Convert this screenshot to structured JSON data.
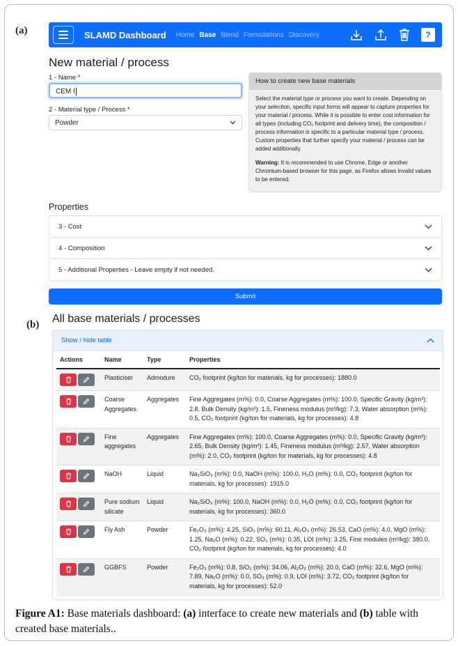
{
  "panel_labels": {
    "a": "(a)",
    "b": "(b)"
  },
  "navbar": {
    "brand": "SLAMD Dashboard",
    "links": [
      {
        "label": "Home",
        "active": false
      },
      {
        "label": "Base",
        "active": true
      },
      {
        "label": "Blend",
        "active": false
      },
      {
        "label": "Formulations",
        "active": false
      },
      {
        "label": "Discovery",
        "active": false
      }
    ],
    "icons": [
      "download-icon",
      "upload-icon",
      "trash-icon",
      "help-icon"
    ],
    "help_label": "?"
  },
  "form": {
    "title": "New material / process",
    "name_label": "1 - Name *",
    "name_value": "CEM I",
    "type_label": "2 - Material type / Process *",
    "type_value": "Powder"
  },
  "info": {
    "heading": "How to create new base materials",
    "paragraph": "Select the material type or process you want to create. Depending on your selection, specific input forms will appear to capture properties for your material / process. While it is possible to enter cost information for all types (including CO₂ footprint and delivery time), the composition / process information is specific to a particular material type / process. Custom properties that further specify your material / process can be added additionally.",
    "warning_label": "Warning:",
    "warning_text": " It is recommended to use Chrome, Edge or another Chromium-based browser for this page, as Firefox allows invalid values to be entered."
  },
  "properties": {
    "title": "Properties",
    "items": [
      "3 - Cost",
      "4 - Composition",
      "5 - Additional Properties - Leave empty if not needed."
    ],
    "submit_label": "Submit"
  },
  "materials": {
    "title": "All base materials / processes",
    "toggle_label": "Show / hide table",
    "columns": [
      "Actions",
      "Name",
      "Type",
      "Properties"
    ],
    "rows": [
      {
        "name": "Plasticiser",
        "type": "Admixture",
        "properties": "CO₂ footprint (kg/ton for materials, kg for processes): 1880.0"
      },
      {
        "name": "Coarse Aggregates",
        "type": "Aggregates",
        "properties": "Fine Aggregates (m%): 0.0, Coarse Aggregates (m%): 100.0, Specific Gravity (kg/m³): 2.8, Bulk Density (kg/m³): 1.5, Fineness modulus (m³/kg): 7.3, Water absorption (m%): 0.5, CO₂ footprint (kg/ton for materials, kg for processes): 4.8"
      },
      {
        "name": "Fine aggregates",
        "type": "Aggregates",
        "properties": "Fine Aggregates (m%): 100.0, Coarse Aggregates (m%): 0.0, Specific Gravity (kg/m³): 2.65, Bulk Density (kg/m³): 1.45, Fineness modulus (m³/kg): 2.57, Water absorption (m%): 2.0, CO₂ footprint (kg/ton for materials, kg for processes): 4.8"
      },
      {
        "name": "NaOH",
        "type": "Liquid",
        "properties": "Na₂SiO₃ (m%): 0.0, NaOH (m%): 100.0, H₂O (m%): 0.0, CO₂ footprint (kg/ton for materials, kg for processes): 1915.0"
      },
      {
        "name": "Pure sodium silicate",
        "type": "Liquid",
        "properties": "Na₂SiO₃ (m%): 100.0, NaOH (m%): 0.0, H₂O (m%): 0.0, CO₂ footprint (kg/ton for materials, kg for processes): 360.0"
      },
      {
        "name": "Fly Ash",
        "type": "Powder",
        "properties": "Fe₂O₃ (m%): 4.25, SiO₂ (m%): 60.11, Al₂O₃ (m%): 26.53, CaO (m%): 4.0, MgO (m%): 1.25, Na₂O (m%): 0.22, SO₃ (m%): 0.35, LOI (m%): 3.25, Fine modules (m²/kg): 380.0, CO₂ footprint (kg/ton for materials, kg for processes): 4.0"
      },
      {
        "name": "GGBFS",
        "type": "Powder",
        "properties": "Fe₂O₃ (m%): 0.8, SiO₂ (m%): 34.06, Al₂O₃ (m%): 20.0, CaO (m%): 32.6, MgO (m%): 7.89, Na₂O (m%): 0.0, SO₃ (m%): 0.9, LOI (m%): 3.72, CO₂ footprint (kg/ton for materials, kg for processes): 52.0"
      }
    ]
  },
  "caption": {
    "label": "Figure A1:",
    "text1": " Base materials dashboard: ",
    "a": "(a)",
    "text2": " interface to create new materials and ",
    "b": "(b)",
    "text3": " table with created base materials.."
  }
}
